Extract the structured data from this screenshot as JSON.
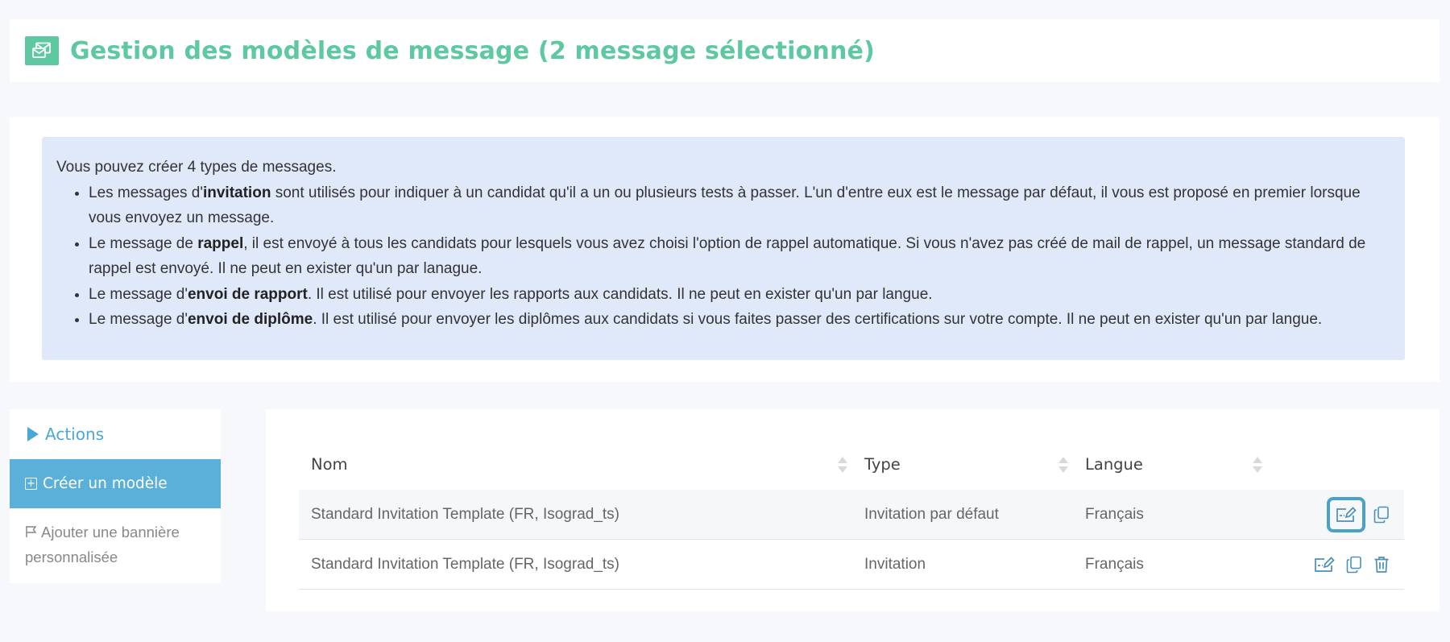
{
  "header": {
    "title": "Gestion des modèles de message (2 message sélectionné)",
    "icon": "envelopes-icon",
    "accent": "#5ec8a0"
  },
  "info": {
    "intro": "Vous pouvez créer 4 types de messages.",
    "items": [
      {
        "pre": "Les messages d'",
        "bold": "invitation",
        "post": " sont utilisés pour indiquer à un candidat qu'il a un ou plusieurs tests à passer. L'un d'entre eux est le message par défaut, il vous est proposé en premier lorsque vous envoyez un message."
      },
      {
        "pre": "Le message de ",
        "bold": "rappel",
        "post": ", il est envoyé à tous les candidats pour lesquels vous avez choisi l'option de rappel automatique. Si vous n'avez pas créé de mail de rappel, un message standard de rappel est envoyé. Il ne peut en exister qu'un par lanague."
      },
      {
        "pre": "Le message d'",
        "bold": "envoi de rapport",
        "post": ". Il est utilisé pour envoyer les rapports aux candidats. Il ne peut en exister qu'un par langue."
      },
      {
        "pre": "Le message d'",
        "bold": "envoi de diplôme",
        "post": ". Il est utilisé pour envoyer les diplômes aux candidats si vous faites passer des certifications sur votre compte. Il ne peut en exister qu'un par langue."
      }
    ]
  },
  "actions": {
    "title": "Actions",
    "create_label": "Créer un modèle",
    "banner_label": "Ajouter une bannière personnalisée"
  },
  "table": {
    "columns": [
      "Nom",
      "Type",
      "Langue"
    ],
    "rows": [
      {
        "name": "Standard Invitation Template (FR, Isograd_ts)",
        "type": "Invitation par défaut",
        "lang": "Français"
      },
      {
        "name": "Standard Invitation Template (FR, Isograd_ts)",
        "type": "Invitation",
        "lang": "Français"
      }
    ]
  },
  "colors": {
    "actions_blue": "#5ab0d9",
    "info_bg": "#dfe9fa",
    "icon_blue": "#4a90b8"
  }
}
